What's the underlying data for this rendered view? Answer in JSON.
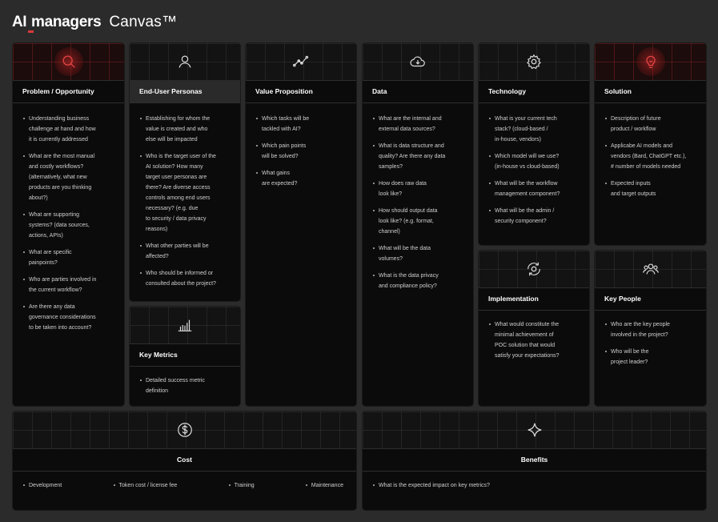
{
  "header": {
    "logo_ai": "AI",
    "logo_managers": "managers",
    "title": "Canvas™"
  },
  "accent_color": "#d93a3a",
  "cards": {
    "problem": {
      "icon": "search-icon",
      "title": "Problem / Opportunity",
      "items": [
        "Understanding business\nchallenge at hand and how\nit is currently addressed",
        "What are the most manual\nand costly workflows?\n(alternatively, what new\nproducts are you thinking\nabout?)",
        "What are supporting\nsystems? (data sources,\nactions, APIs)",
        "What are specific\npainpoints?",
        "Who are parties involved in\nthe current workflow?",
        "Are there any data\ngovernance considerations\nto be taken into account?"
      ]
    },
    "personas": {
      "icon": "user-icon",
      "title": "End-User Personas",
      "items": [
        "Establishing for whom the\nvalue is created and who\nelse will be impacted",
        "Who is the target user of the\nAI solution? How many\ntarget user personas are\nthere? Are diverse access\ncontrols among end users\nnecessary? (e.g. due\nto security / data privacy\nreasons)",
        "What other parties will be\naffected?",
        "Who should be informed or\nconsulted about the project?"
      ]
    },
    "metrics": {
      "icon": "bar-chart-icon",
      "title": "Key Metrics",
      "items": [
        "Detailed success metric\ndefinition"
      ]
    },
    "value": {
      "icon": "trend-line-icon",
      "title": "Value Proposition",
      "items": [
        "Which tasks will be\ntackled with AI?",
        "Which pain points\nwill be solved?",
        "What gains\nare expected?"
      ]
    },
    "data": {
      "icon": "cloud-download-icon",
      "title": "Data",
      "items": [
        "What are the internal and\nexternal data sources?",
        "What is data structure and\nquality? Are there any data\nsamples?",
        "How does raw data\nlook like?",
        "How should output data\nlook like? (e.g. format,\nchannel)",
        "What will be the data\nvolumes?",
        "What is the data privacy\nand compliance policy?"
      ]
    },
    "technology": {
      "icon": "gear-icon",
      "title": "Technology",
      "items": [
        "What is your current tech\nstack? (cloud-based /\nin-house, vendors)",
        "Which model will we use?\n(in-house vs cloud-based)",
        "What will be the workflow\nmanagement component?",
        "What will be the admin /\nsecurity component?"
      ]
    },
    "implementation": {
      "icon": "cycle-gear-icon",
      "title": "Implementation",
      "items": [
        "What would constitute the\nminimal achievement of\nPOC solution that would\nsatisfy your expectations?"
      ]
    },
    "solution": {
      "icon": "lightbulb-icon",
      "title": "Solution",
      "items": [
        "Description of future\nproduct / workflow",
        "Applicabe AI models and\nvendors (Bard, ChatGPT etc.),\n# number of models needed",
        "Expected inputs\nand target outputs"
      ]
    },
    "people": {
      "icon": "people-group-icon",
      "title": "Key People",
      "items": [
        "Who are the key people\ninvolved in the project?",
        "Who will be the\nproject leader?"
      ]
    },
    "cost": {
      "icon": "dollar-coin-icon",
      "title": "Cost",
      "items": [
        "Development",
        "Token cost / license fee",
        "Training",
        "Maintenance"
      ]
    },
    "benefits": {
      "icon": "sparkle-icon",
      "title": "Benefits",
      "items": [
        "What is the expected impact on key metrics?"
      ]
    }
  }
}
